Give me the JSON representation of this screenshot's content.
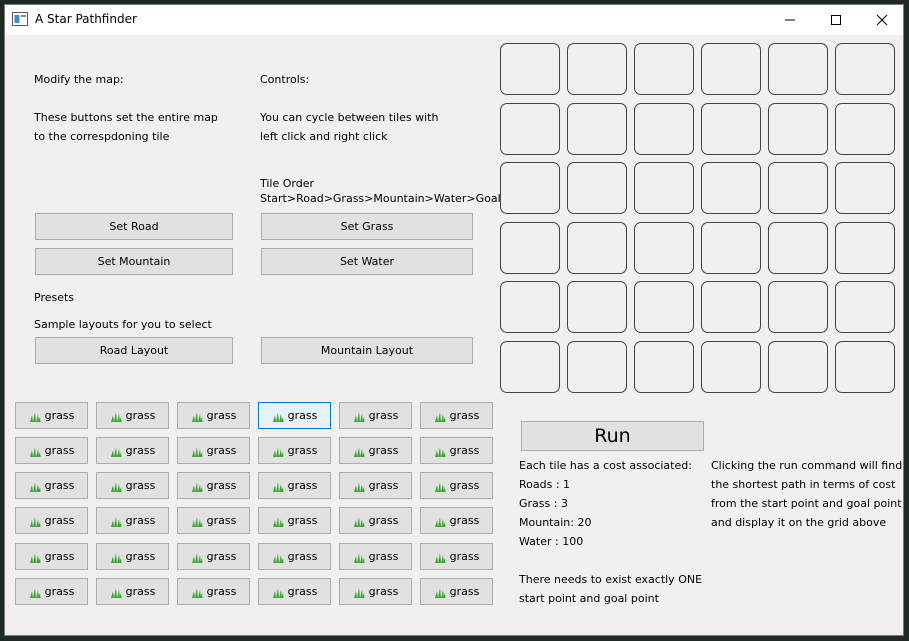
{
  "window": {
    "title": "A Star Pathfinder",
    "minimize_icon": "minimize-icon",
    "maximize_icon": "maximize-icon",
    "close_icon": "close-icon"
  },
  "modify": {
    "heading": "Modify the map:",
    "line1": "These buttons set the entire map",
    "line2": "to the correspdoning tile"
  },
  "controls": {
    "heading": "Controls:",
    "line1": "You can cycle between tiles with",
    "line2": "left click and right click",
    "order_label": "Tile Order",
    "order_value": " Start>Road>Grass>Mountain>Water>Goal"
  },
  "buttons": {
    "set_road": "Set Road",
    "set_grass": "Set Grass",
    "set_mountain": "Set Mountain",
    "set_water": "Set Water",
    "road_layout": "Road Layout",
    "mountain_layout": "Mountain Layout",
    "run": "Run"
  },
  "presets": {
    "heading": "Presets",
    "desc": "Sample layouts for you to select"
  },
  "tiles": {
    "icon": "grass-icon",
    "rows": [
      [
        "grass",
        "grass",
        "grass",
        "grass",
        "grass",
        "grass"
      ],
      [
        "grass",
        "grass",
        "grass",
        "grass",
        "grass",
        "grass"
      ],
      [
        "grass",
        "grass",
        "grass",
        "grass",
        "grass",
        "grass"
      ],
      [
        "grass",
        "grass",
        "grass",
        "grass",
        "grass",
        "grass"
      ],
      [
        "grass",
        "grass",
        "grass",
        "grass",
        "grass",
        "grass"
      ],
      [
        "grass",
        "grass",
        "grass",
        "grass",
        "grass",
        "grass"
      ]
    ]
  },
  "costs": {
    "heading": "Each tile has a cost associated:",
    "roads": "Roads : 1",
    "grass": "Grass : 3",
    "mountain": "Mountain: 20",
    "water": "Water : 100",
    "note1": "There needs to exist exactly ONE",
    "note2": "start point and goal point"
  },
  "run_help": {
    "line1": "Clicking the run command will find",
    "line2": "the shortest path in terms of cost",
    "line3": "from the start point and goal point",
    "line4": "and display it on the grid above"
  },
  "colors": {
    "grass": "#3fa535",
    "selected_border": "#0078d7"
  }
}
